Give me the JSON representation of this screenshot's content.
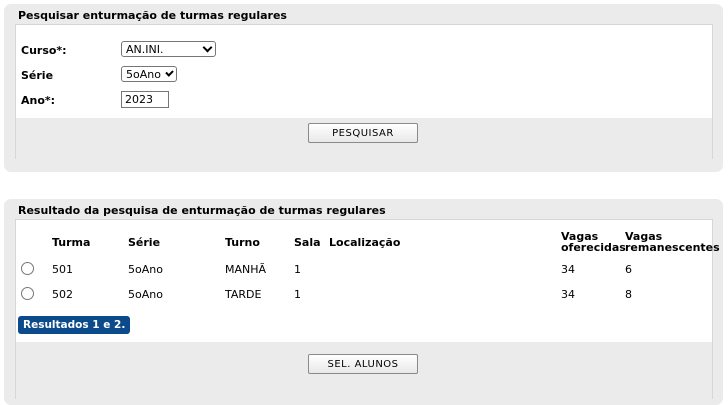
{
  "search": {
    "title": "Pesquisar enturmação de turmas regulares",
    "curso_label": "Curso*:",
    "curso_value": "AN.INI.",
    "serie_label": "Série",
    "serie_value": "5oAno",
    "ano_label": "Ano*:",
    "ano_value": "2023",
    "button_label": "PESQUISAR"
  },
  "results": {
    "title": "Resultado da pesquisa de enturmação de turmas regulares",
    "headers": {
      "turma": "Turma",
      "serie": "Série",
      "turno": "Turno",
      "sala": "Sala",
      "localizacao": "Localização",
      "vagas_oferecidas": [
        "Vagas",
        "oferecidas"
      ],
      "vagas_remanescentes": [
        "Vagas",
        "remanescentes"
      ]
    },
    "rows": [
      {
        "turma": "501",
        "serie": "5oAno",
        "turno": "MANHÃ",
        "sala": "1",
        "localizacao": "",
        "vagas_oferecidas": "34",
        "vagas_remanescentes": "6"
      },
      {
        "turma": "502",
        "serie": "5oAno",
        "turno": "TARDE",
        "sala": "1",
        "localizacao": "",
        "vagas_oferecidas": "34",
        "vagas_remanescentes": "8"
      }
    ],
    "summary": "Resultados 1 e 2.",
    "button_label": "SEL. ALUNOS"
  },
  "colors": {
    "badge": "#0b4a8b",
    "panel": "#ebebeb"
  }
}
